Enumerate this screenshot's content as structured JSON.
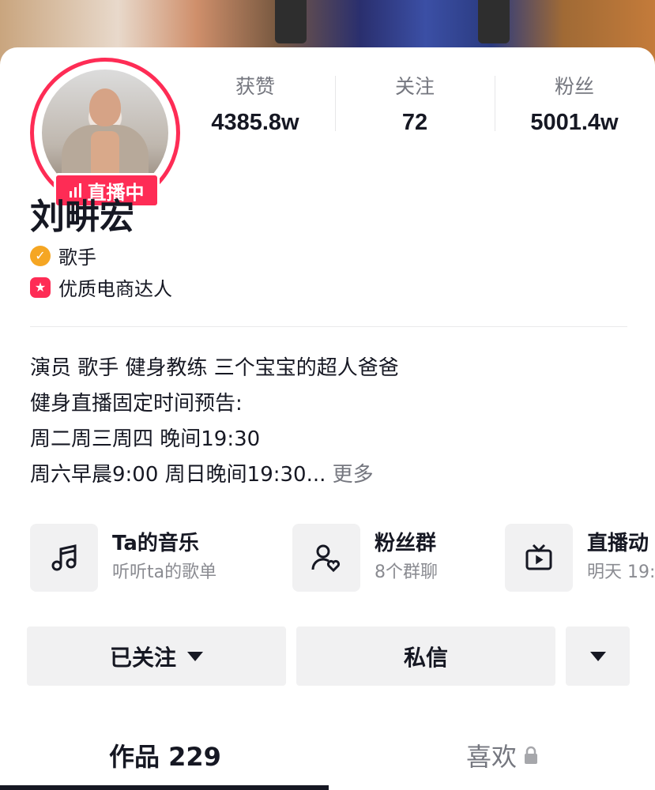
{
  "profile": {
    "live_badge": "直播中",
    "name": "刘畊宏",
    "tags": [
      {
        "label": "歌手",
        "icon": "verified-check-icon",
        "color": "#f5a623"
      },
      {
        "label": "优质电商达人",
        "icon": "star-badge-icon",
        "color": "#fe2c55"
      }
    ]
  },
  "stats": [
    {
      "label": "获赞",
      "value": "4385.8w"
    },
    {
      "label": "关注",
      "value": "72"
    },
    {
      "label": "粉丝",
      "value": "5001.4w"
    }
  ],
  "bio": {
    "lines": [
      "演员 歌手 健身教练 三个宝宝的超人爸爸",
      "健身直播固定时间预告:",
      "周二周三周四 晚间19:30",
      "周六早晨9:00 周日晚间19:30..."
    ],
    "more": "更多"
  },
  "features": [
    {
      "title": "Ta的音乐",
      "subtitle": "听听ta的歌单",
      "icon": "music-note-icon"
    },
    {
      "title": "粉丝群",
      "subtitle": "8个群聊",
      "icon": "fan-group-icon"
    },
    {
      "title": "直播动",
      "subtitle": "明天 19:",
      "icon": "tv-icon"
    }
  ],
  "actions": {
    "follow": "已关注",
    "message": "私信"
  },
  "tabs": [
    {
      "label": "作品 229"
    },
    {
      "label": "喜欢"
    }
  ],
  "colors": {
    "accent": "#fe2c55",
    "text": "#161823",
    "secondary": "#75777f",
    "button_bg": "#f1f1f2"
  }
}
